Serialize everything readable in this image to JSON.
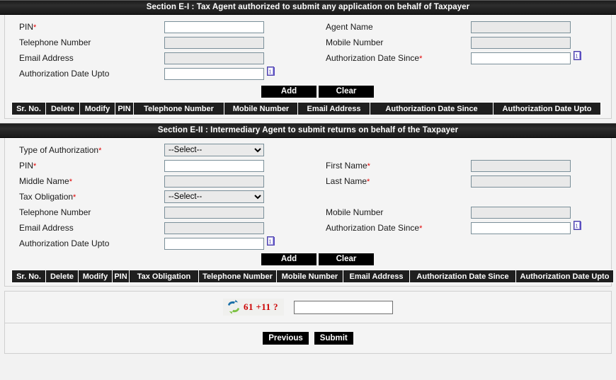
{
  "colors": {
    "section_bar_bg": "#1f1f1f",
    "required_asterisk": "#e00000",
    "captcha_text": "#cc0000",
    "button_bg": "#000000",
    "panel_bg": "#f4f4f4"
  },
  "section_e1": {
    "title": "Section E-I : Tax Agent authorized to submit any application on behalf of Taxpayer",
    "fields": [
      {
        "label": "PIN",
        "required": true,
        "type": "text",
        "value": "",
        "disabled": false,
        "calendar": false
      },
      {
        "label": "Agent Name",
        "required": false,
        "type": "text",
        "value": "",
        "disabled": true,
        "calendar": false
      },
      {
        "label": "Telephone Number",
        "required": false,
        "type": "text",
        "value": "",
        "disabled": true,
        "calendar": false
      },
      {
        "label": "Mobile Number",
        "required": false,
        "type": "text",
        "value": "",
        "disabled": true,
        "calendar": false
      },
      {
        "label": "Email Address",
        "required": false,
        "type": "text",
        "value": "",
        "disabled": true,
        "calendar": false
      },
      {
        "label": "Authorization Date Since",
        "required": true,
        "type": "text",
        "value": "",
        "disabled": false,
        "calendar": true
      },
      {
        "label": "Authorization Date Upto",
        "required": false,
        "type": "text",
        "value": "",
        "disabled": false,
        "calendar": true
      }
    ],
    "add_label": "Add",
    "clear_label": "Clear",
    "table_headers": [
      "Sr. No.",
      "Delete",
      "Modify",
      "PIN",
      "Telephone Number",
      "Mobile Number",
      "Email Address",
      "Authorization Date Since",
      "Authorization Date Upto"
    ]
  },
  "section_e2": {
    "title": "Section E-II : Intermediary Agent to submit returns on behalf of the Taxpayer",
    "fields": [
      {
        "label": "Type of Authorization",
        "required": true,
        "type": "select",
        "value": "--Select--",
        "disabled": false,
        "calendar": false
      },
      {
        "label": "PIN",
        "required": true,
        "type": "text",
        "value": "",
        "disabled": false,
        "calendar": false
      },
      {
        "label": "First Name",
        "required": true,
        "type": "text",
        "value": "",
        "disabled": true,
        "calendar": false
      },
      {
        "label": "Middle Name",
        "required": true,
        "type": "text",
        "value": "",
        "disabled": true,
        "calendar": false
      },
      {
        "label": "Last Name",
        "required": true,
        "type": "text",
        "value": "",
        "disabled": true,
        "calendar": false
      },
      {
        "label": "Tax Obligation",
        "required": true,
        "type": "select",
        "value": "--Select--",
        "disabled": false,
        "calendar": false
      },
      {
        "label": "Telephone Number",
        "required": false,
        "type": "text",
        "value": "",
        "disabled": true,
        "calendar": false
      },
      {
        "label": "Mobile Number",
        "required": false,
        "type": "text",
        "value": "",
        "disabled": true,
        "calendar": false
      },
      {
        "label": "Email Address",
        "required": false,
        "type": "text",
        "value": "",
        "disabled": true,
        "calendar": false
      },
      {
        "label": "Authorization Date Since",
        "required": true,
        "type": "text",
        "value": "",
        "disabled": false,
        "calendar": true
      },
      {
        "label": "Authorization Date Upto",
        "required": false,
        "type": "text",
        "value": "",
        "disabled": false,
        "calendar": true
      }
    ],
    "select_options": [
      "--Select--"
    ],
    "add_label": "Add",
    "clear_label": "Clear",
    "table_headers": [
      "Sr. No.",
      "Delete",
      "Modify",
      "PIN",
      "Tax Obligation",
      "Telephone Number",
      "Mobile Number",
      "Email Address",
      "Authorization Date Since",
      "Authorization Date Upto"
    ]
  },
  "captcha": {
    "question": "61 +11 ?",
    "answer_value": "",
    "refresh_icon": "refresh-icon"
  },
  "footer": {
    "previous_label": "Previous",
    "submit_label": "Submit"
  }
}
